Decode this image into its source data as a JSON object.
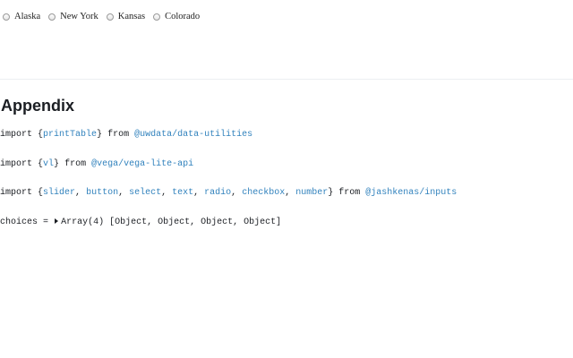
{
  "radio_options": [
    "Alaska",
    "New York",
    "Kansas",
    "Colorado"
  ],
  "appendix": {
    "title": "Appendix",
    "lines": [
      {
        "keyword": "import",
        "names": [
          "printTable"
        ],
        "from": "from",
        "source": "@uwdata/data-utilities"
      },
      {
        "keyword": "import",
        "names": [
          "vl"
        ],
        "from": "from",
        "source": "@vega/vega-lite-api"
      },
      {
        "keyword": "import",
        "names": [
          "slider",
          "button",
          "select",
          "text",
          "radio",
          "checkbox",
          "number"
        ],
        "from": "from",
        "source": "@jashkenas/inputs"
      }
    ],
    "choices": {
      "label": "choices",
      "equals": "=",
      "value": "Array(4) [Object, Object, Object, Object]"
    }
  }
}
